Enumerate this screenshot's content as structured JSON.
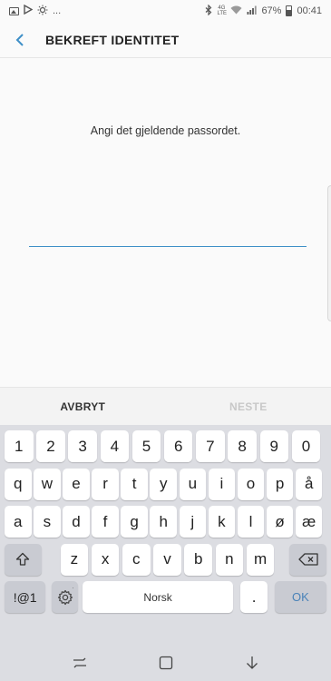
{
  "status_bar": {
    "notification_more": "...",
    "network_label": "4G LTE",
    "battery": "67%",
    "time": "00:41",
    "icons": [
      "gallery-icon",
      "play-store-icon",
      "brightness-icon",
      "bluetooth-icon",
      "network-4g-icon",
      "wifi-icon",
      "signal-icon",
      "battery-icon"
    ]
  },
  "header": {
    "title": "BEKREFT IDENTITET",
    "back_icon": "back-arrow-icon",
    "accent_color": "#3e8fc7"
  },
  "content": {
    "prompt": "Angi det gjeldende passordet.",
    "password_value": ""
  },
  "actions": {
    "cancel_label": "AVBRYT",
    "next_label": "NESTE",
    "next_enabled": false
  },
  "keyboard": {
    "row1": [
      "1",
      "2",
      "3",
      "4",
      "5",
      "6",
      "7",
      "8",
      "9",
      "0"
    ],
    "row2": [
      "q",
      "w",
      "e",
      "r",
      "t",
      "y",
      "u",
      "i",
      "o",
      "p",
      "å"
    ],
    "row3": [
      "a",
      "s",
      "d",
      "f",
      "g",
      "h",
      "j",
      "k",
      "l",
      "ø",
      "æ"
    ],
    "row4": [
      "z",
      "x",
      "c",
      "v",
      "b",
      "n",
      "m"
    ],
    "shift_icon": "shift-icon",
    "backspace_icon": "backspace-icon",
    "num_sym_label": "!@1",
    "settings_icon": "gear-icon",
    "space_label": "Norsk",
    "period_label": ".",
    "ok_label": "OK"
  },
  "nav_bar": {
    "icons": [
      "recent-apps-icon",
      "home-icon",
      "back-icon"
    ]
  }
}
